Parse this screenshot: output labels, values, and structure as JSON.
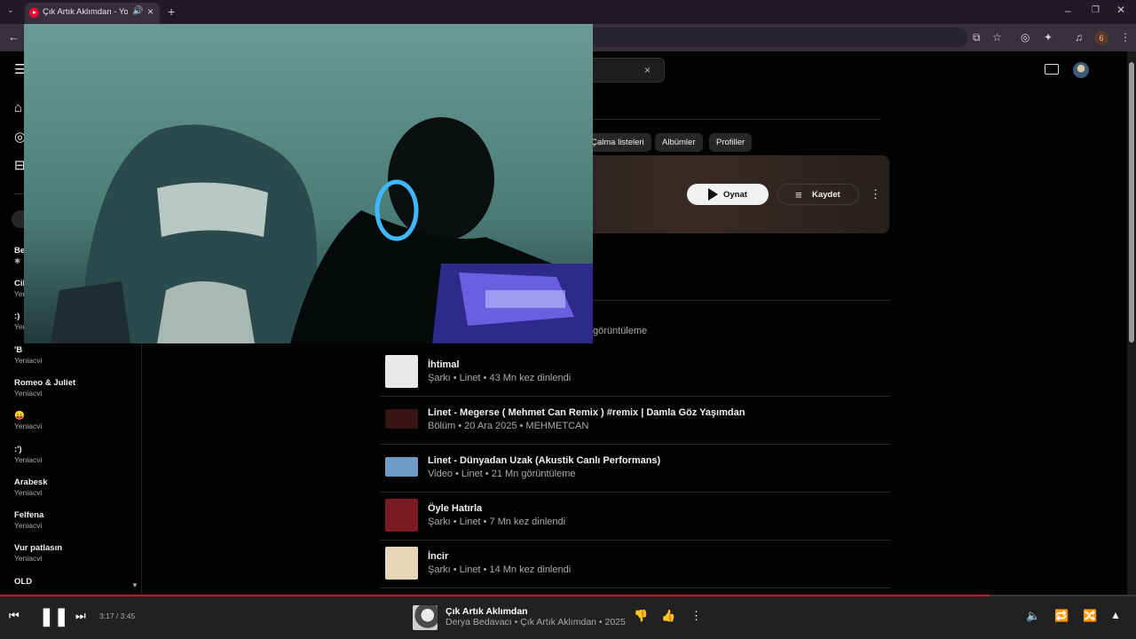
{
  "browser": {
    "tab_title": "Çık Artık Aklımdan - YouTube Music",
    "new_tab": "+",
    "profile_badge": "6"
  },
  "search": {
    "clear": "×"
  },
  "chips": [
    "Çalma listeleri",
    "Albümler",
    "Profiller"
  ],
  "top_result": {
    "play_label": "Oynat",
    "save_label": "Kaydet"
  },
  "partial_row_text": "görüntüleme",
  "sidebar": {
    "playlists": [
      {
        "title": "Be",
        "sub": "✱"
      },
      {
        "title": "Cil",
        "sub": "Yeniacvi"
      },
      {
        "title": ":)",
        "sub": "Yeniacvi"
      },
      {
        "title": "'B",
        "sub": "Yeniacvi"
      },
      {
        "title": "Romeo & Juliet",
        "sub": "Yeniacvi"
      },
      {
        "title": "😛",
        "sub": "Yeniacvi"
      },
      {
        "title": ":')",
        "sub": "Yeniacvi"
      },
      {
        "title": "Arabesk",
        "sub": "Yeniacvi"
      },
      {
        "title": "Felfena",
        "sub": "Yeniacvi"
      },
      {
        "title": "Vur patlasın",
        "sub": "Yeniacvi"
      },
      {
        "title": "OLD",
        "sub": ""
      }
    ]
  },
  "results": [
    {
      "title": "İhtimal",
      "sub": "Şarkı • Linet • 43 Mn kez dinlendi",
      "thumb": "#e9e9e9"
    },
    {
      "title": "Linet - Megerse ( Mehmet Can Remix ) #remix | Damla Göz Yaşımdan",
      "sub": "Bölüm • 20 Ara 2025 • MEHMETCAN",
      "thumb": "#3a1414"
    },
    {
      "title": "Linet - Dünyadan Uzak (Akustik Canlı Performans)",
      "sub": "Video • Linet • 21 Mn görüntüleme",
      "thumb": "#6f9ac7"
    },
    {
      "title": "Öyle Hatırla",
      "sub": "Şarkı • Linet • 7 Mn kez dinlendi",
      "thumb": "#7a1a22"
    },
    {
      "title": "İncir",
      "sub": "Şarkı • Linet • 14 Mn kez dinlendi",
      "thumb": "#e8d6b8"
    }
  ],
  "player": {
    "time": "3:17 / 3:45",
    "progress": 0.874,
    "title": "Çık Artık Aklımdan",
    "subtitle": "Derya Bedavacı • Çık Artık Aklımdan • 2025"
  },
  "colors": {
    "accent": "#ff0033",
    "background": "#030303"
  }
}
